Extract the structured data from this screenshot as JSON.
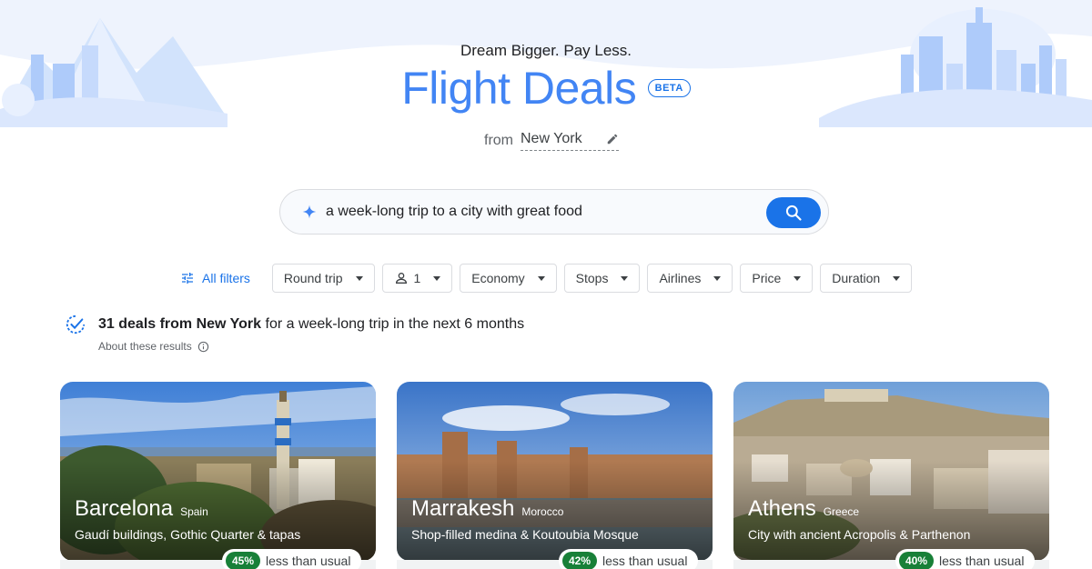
{
  "header": {
    "tagline": "Dream Bigger. Pay Less.",
    "title": "Flight Deals",
    "badge": "BETA",
    "from_label": "from",
    "from_city": "New York"
  },
  "search": {
    "query": "a week-long trip to a city with great food",
    "icon": "sparkle-icon",
    "button_icon": "search-icon"
  },
  "filters": {
    "all_filters_label": "All filters",
    "chips": [
      {
        "label": "Round trip"
      },
      {
        "label": "1",
        "icon": "person-icon"
      },
      {
        "label": "Economy"
      },
      {
        "label": "Stops"
      },
      {
        "label": "Airlines"
      },
      {
        "label": "Price"
      },
      {
        "label": "Duration"
      }
    ]
  },
  "results": {
    "count_text": "31 deals from New York",
    "rest_text": " for a week-long trip in the next 6 months",
    "about_label": "About these results"
  },
  "cards": [
    {
      "city": "Barcelona",
      "country": "Spain",
      "description": "Gaudí buildings, Gothic Quarter & tapas",
      "percent": "45%",
      "less_label": "less than usual"
    },
    {
      "city": "Marrakesh",
      "country": "Morocco",
      "description": "Shop-filled medina & Koutoubia Mosque",
      "percent": "42%",
      "less_label": "less than usual"
    },
    {
      "city": "Athens",
      "country": "Greece",
      "description": "City with ancient Acropolis & Parthenon",
      "percent": "40%",
      "less_label": "less than usual"
    }
  ],
  "colors": {
    "accent": "#1a73e8",
    "title_blue": "#4285f4",
    "deal_green": "#188038"
  }
}
